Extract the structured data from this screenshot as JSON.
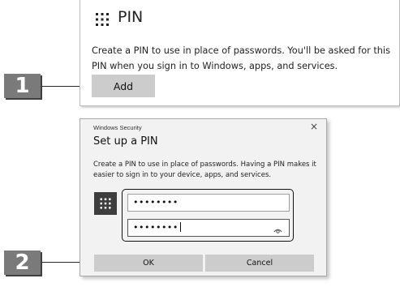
{
  "steps": {
    "step1": "1",
    "step2": "2"
  },
  "pin_card": {
    "icon": "keypad-grid-icon",
    "title": "PIN",
    "description": "Create a PIN to use in place of passwords. You'll be asked for this PIN when you sign in to Windows, apps, and services.",
    "add_label": "Add"
  },
  "dialog": {
    "app_title": "Windows Security",
    "close_glyph": "×",
    "heading": "Set up a PIN",
    "description": "Create a PIN to use in place of passwords. Having a PIN makes it easier to sign in to your device, apps, and services.",
    "new_pin_value": "••••••••",
    "confirm_pin_value": "••••••••",
    "ok_label": "OK",
    "cancel_label": "Cancel"
  },
  "colors": {
    "badge": "#7a7a7a",
    "button_gray": "#cccccc",
    "dialog_bg": "#f2f2f2",
    "keypad_tile": "#3d3d3d"
  }
}
